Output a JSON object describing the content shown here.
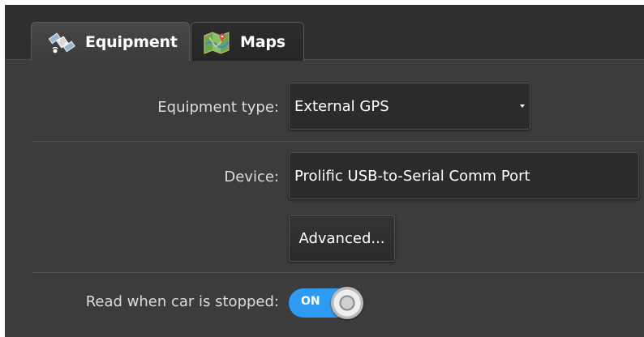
{
  "tabs": [
    {
      "label": "Equipment",
      "icon": "satellite-icon",
      "active": true
    },
    {
      "label": "Maps",
      "icon": "map-icon",
      "active": false
    }
  ],
  "form": {
    "equipment_type_label": "Equipment type:",
    "equipment_type_value": "External GPS",
    "device_label": "Device:",
    "device_value": "Prolific USB-to-Serial Comm Port",
    "advanced_button": "Advanced...",
    "read_when_stopped_label": "Read when car is stopped:",
    "read_when_stopped_toggle": "ON"
  },
  "colors": {
    "background": "#3c3c3c",
    "tab_strip": "#2f2f2f",
    "toggle_on": "#2e9af2"
  }
}
